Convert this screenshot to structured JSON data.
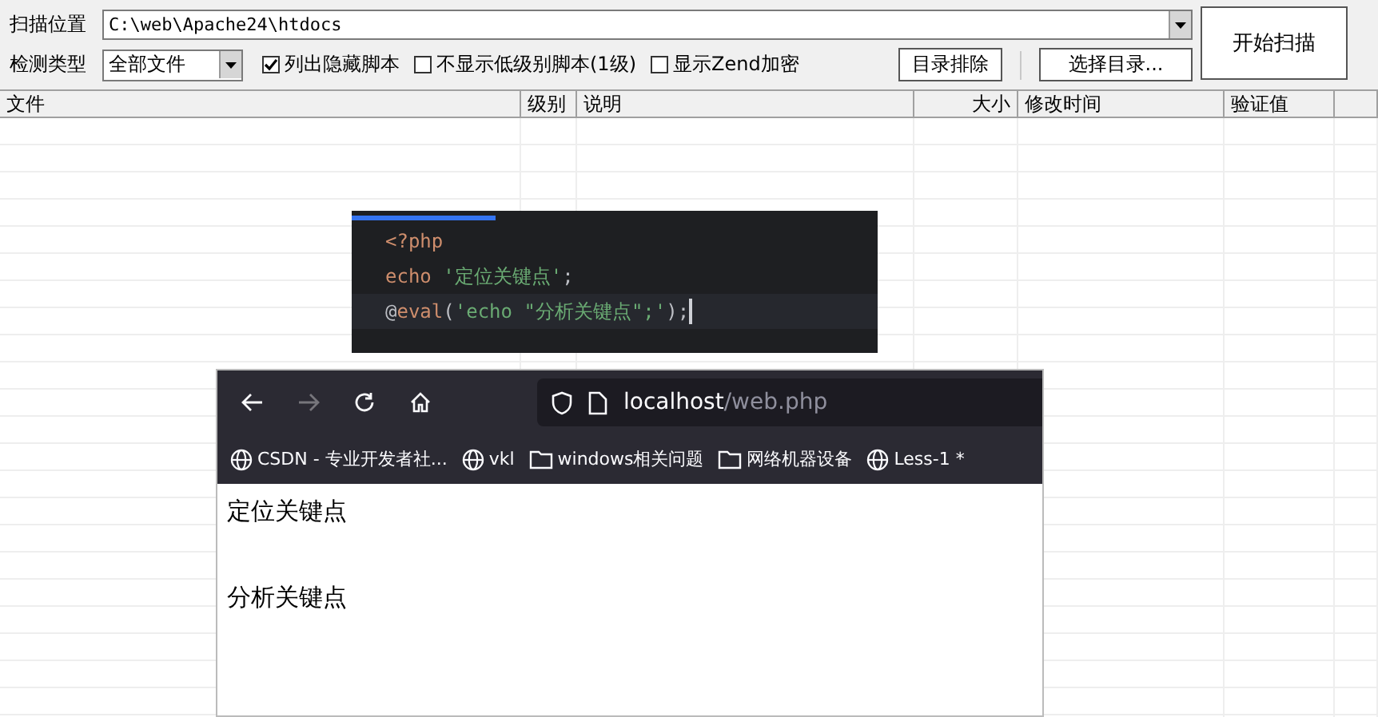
{
  "scan_location": {
    "label": "扫描位置",
    "value": "C:\\web\\Apache24\\htdocs"
  },
  "detect_type": {
    "label": "检测类型",
    "value": "全部文件"
  },
  "options": [
    {
      "label": "列出隐藏脚本",
      "checked": true
    },
    {
      "label": "不显示低级别脚本(1级)",
      "checked": false
    },
    {
      "label": "显示Zend加密",
      "checked": false
    }
  ],
  "buttons": [
    "目录排除",
    "选择目录..."
  ],
  "start_button": "开始扫描",
  "table": {
    "columns": [
      {
        "label": "文件"
      },
      {
        "label": "级别"
      },
      {
        "label": "说明"
      },
      {
        "label": "大小"
      },
      {
        "label": "修改时间"
      },
      {
        "label": "验证值"
      }
    ]
  },
  "code_editor": {
    "lines": [
      {
        "current": false,
        "tokens": [
          {
            "kind": "keyword",
            "text": "<?php"
          }
        ]
      },
      {
        "current": false,
        "tokens": [
          {
            "kind": "keyword",
            "text": "echo "
          },
          {
            "kind": "string",
            "text": "'定位关键点'"
          },
          {
            "kind": "plain",
            "text": ";"
          }
        ]
      },
      {
        "current": true,
        "tokens": [
          {
            "kind": "plain",
            "text": "@"
          },
          {
            "kind": "keyword",
            "text": "eval"
          },
          {
            "kind": "plain",
            "text": "("
          },
          {
            "kind": "string",
            "text": "'echo \"分析关键点\";'"
          },
          {
            "kind": "plain",
            "text": ");"
          }
        ]
      }
    ]
  },
  "browser": {
    "url_host": "localhost",
    "url_path": "/web.php",
    "bookmarks": [
      {
        "kind": "globe",
        "label": "CSDN - 专业开发者社..."
      },
      {
        "kind": "globe",
        "label": "vkl"
      },
      {
        "kind": "folder",
        "label": "windows相关问题"
      },
      {
        "kind": "folder",
        "label": "网络机器设备"
      },
      {
        "kind": "globe",
        "label": "Less-1 *"
      }
    ],
    "content": [
      "定位关键点",
      "分析关键点"
    ]
  }
}
